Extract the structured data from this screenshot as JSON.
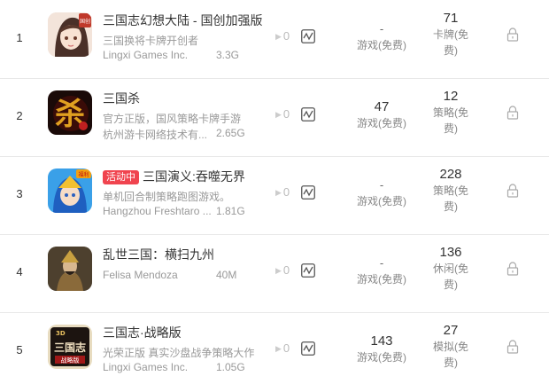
{
  "rows": [
    {
      "rank": "1",
      "badge": "",
      "title": "三国志幻想大陆 - 国创加强版",
      "subtitle": "三国换将卡牌开创者",
      "developer": "Lingxi Games Inc.",
      "size": "3.3G",
      "change": "0",
      "free_rank": "-",
      "free_label": "游戏(免费)",
      "cat_rank": "71",
      "cat_label_1": "卡牌(免",
      "cat_label_2": "费)",
      "icon": "anime-girl-app-icon"
    },
    {
      "rank": "2",
      "badge": "",
      "title": "三国杀",
      "subtitle": "官方正版，国风策略卡牌手游",
      "developer": "杭州游卡网络技术有...",
      "size": "2.65G",
      "change": "0",
      "free_rank": "47",
      "free_label": "游戏(免费)",
      "cat_rank": "12",
      "cat_label_1": "策略(免",
      "cat_label_2": "费)",
      "icon": "sanguosha-app-icon"
    },
    {
      "rank": "3",
      "badge": "活动中",
      "title": "三国演义:吞噬无界",
      "subtitle": "单机回合制策略跑图游戏。",
      "developer": "Hangzhou Freshtaro ...",
      "size": "1.81G",
      "change": "0",
      "free_rank": "-",
      "free_label": "游戏(免费)",
      "cat_rank": "228",
      "cat_label_1": "策略(免",
      "cat_label_2": "费)",
      "icon": "cartoon-hero-app-icon"
    },
    {
      "rank": "4",
      "badge": "",
      "title": "乱世三国：横扫九州",
      "subtitle": "",
      "developer": "Felisa Mendoza",
      "size": "40M",
      "change": "0",
      "free_rank": "-",
      "free_label": "游戏(免费)",
      "cat_rank": "136",
      "cat_label_1": "休闲(免",
      "cat_label_2": "费)",
      "icon": "warrior-portrait-app-icon"
    },
    {
      "rank": "5",
      "badge": "",
      "title": "三国志·战略版",
      "subtitle": "光荣正版 真实沙盘战争策略大作",
      "developer": "Lingxi Games Inc.",
      "size": "1.05G",
      "change": "0",
      "free_rank": "143",
      "free_label": "游戏(免费)",
      "cat_rank": "27",
      "cat_label_1": "模拟(免",
      "cat_label_2": "费)",
      "icon": "sanguozhi-strategy-app-icon"
    }
  ],
  "icon_texts": {
    "row1_corner": "国创",
    "row2_glyph": "杀",
    "row3_corner": "福利",
    "row5_top": "3D",
    "row5_main": "三国志",
    "row5_bottom": "战略版"
  },
  "colors": {
    "badge": "#f0444f",
    "border": "#e8e8e8",
    "muted_text": "#999999"
  },
  "icons": {
    "change_arrow": "caret-right-icon",
    "trend": "trend-chart-icon",
    "lock": "lock-icon"
  }
}
